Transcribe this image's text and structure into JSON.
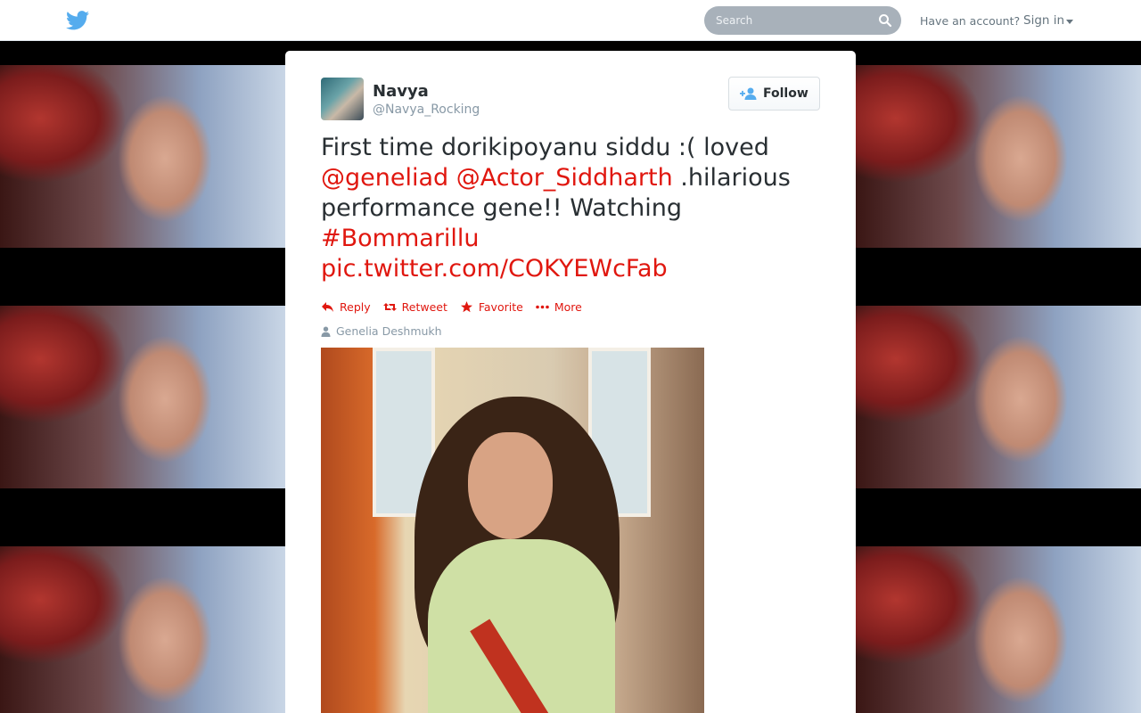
{
  "header": {
    "search_placeholder": "Search",
    "have_account": "Have an account?",
    "sign_in": "Sign in"
  },
  "tweet": {
    "author_name": "Navya",
    "author_handle": "@Navya_Rocking",
    "follow_label": "Follow",
    "text_parts": {
      "p1": "First time dorikipoyanu siddu :( loved ",
      "mention1": "@geneliad",
      "mention2": "@Actor_Siddharth",
      "p2": " .hilarious performance gene!! Watching ",
      "hashtag": "#Bommarillu",
      "link": "pic.twitter.com/COKYEWcFab"
    },
    "actions": {
      "reply": "Reply",
      "retweet": "Retweet",
      "favorite": "Favorite",
      "more": "More"
    },
    "tagged_person": "Genelia Deshmukh"
  },
  "colors": {
    "link": "#e0170f",
    "twitter_blue": "#55acee",
    "text": "#292f33",
    "muted": "#8899a6"
  }
}
